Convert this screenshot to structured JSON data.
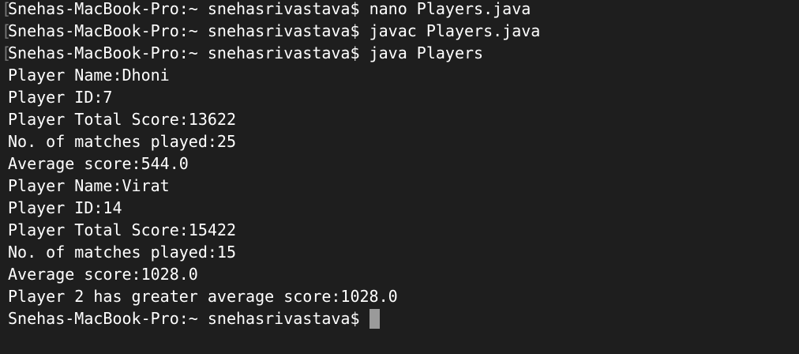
{
  "terminal": {
    "prompt": "Snehas-MacBook-Pro:~ snehasrivastava$",
    "commands": [
      {
        "marker": "[",
        "text": "nano Players.java"
      },
      {
        "marker": "[",
        "text": "javac Players.java"
      },
      {
        "marker": "[",
        "text": "java Players"
      }
    ],
    "output": [
      "Player Name:Dhoni",
      "Player ID:7",
      "Player Total Score:13622",
      "No. of matches played:25",
      "Average score:544.0",
      "Player Name:Virat",
      "Player ID:14",
      "Player Total Score:15422",
      "No. of matches played:15",
      "Average score:1028.0",
      "Player 2 has greater average score:1028.0"
    ],
    "final_prompt": "Snehas-MacBook-Pro:~ snehasrivastava$"
  },
  "colors": {
    "background": "#1e1e1e",
    "text": "#ffffff",
    "cursor": "#9a9a9a",
    "marker": "#777777"
  }
}
